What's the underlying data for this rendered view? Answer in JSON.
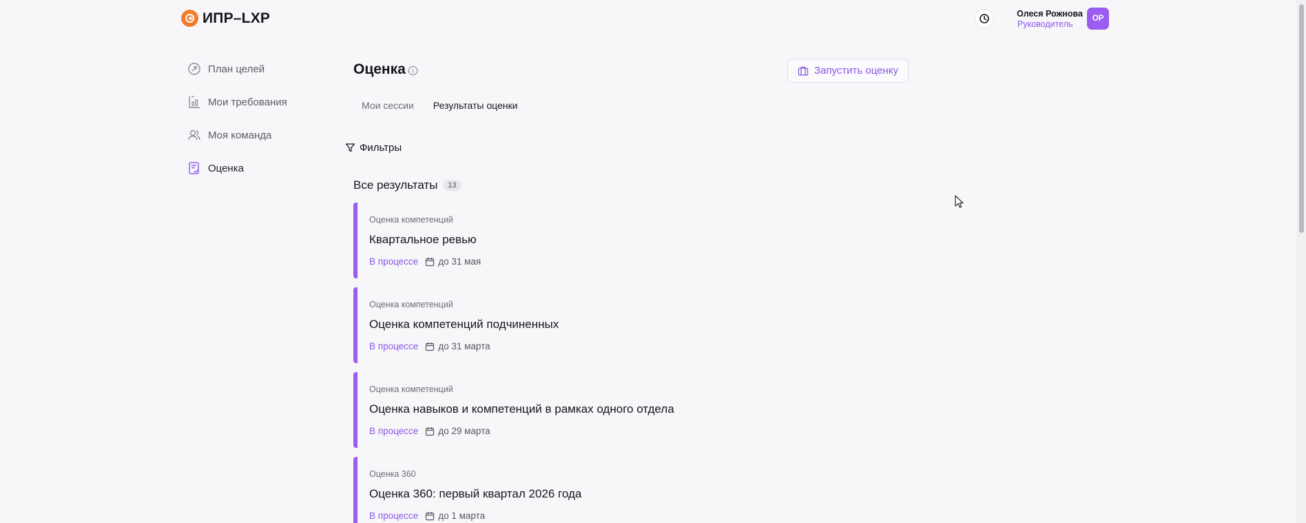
{
  "header": {
    "logo_text": "ИПР–LXP",
    "user_name": "Олеся Рожнова",
    "user_role": "Руководитель",
    "avatar_initials": "ОР",
    "accent": "#9b5cf0",
    "logo_color": "#f47b2a"
  },
  "sidebar": {
    "items": [
      {
        "label": "План целей",
        "icon": "goal-arrow-icon"
      },
      {
        "label": "Мои требования",
        "icon": "requirements-chart-icon"
      },
      {
        "label": "Моя команда",
        "icon": "team-icon"
      },
      {
        "label": "Оценка",
        "icon": "assessment-checklist-icon"
      }
    ]
  },
  "main": {
    "title": "Оценка",
    "launch_button": "Запустить оценку",
    "tabs": [
      "Мои сессии",
      "Результаты оценки"
    ],
    "filters_label": "Фильтры",
    "section_title": "Все результаты",
    "count": "13",
    "cards": [
      {
        "type": "Оценка компетенций",
        "title": "Квартальное ревью",
        "status": "В процессе",
        "due": "до 31 мая"
      },
      {
        "type": "Оценка компетенций",
        "title": "Оценка компетенций подчиненных",
        "status": "В процессе",
        "due": "до 31 марта"
      },
      {
        "type": "Оценка компетенций",
        "title": "Оценка навыков и компетенций в рамках одного отдела",
        "status": "В процессе",
        "due": "до 29 марта"
      },
      {
        "type": "Оценка 360",
        "title": "Оценка 360: первый квартал 2026 года",
        "status": "В процессе",
        "due": "до 1 марта"
      }
    ]
  }
}
